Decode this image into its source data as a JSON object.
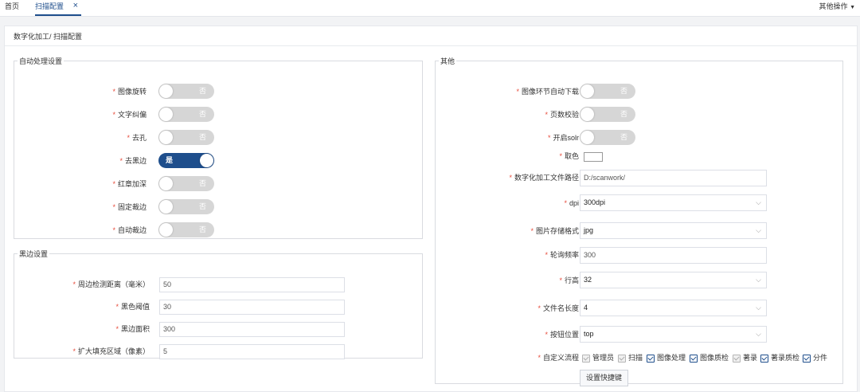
{
  "tabs": {
    "home": "首页",
    "active": "扫描配置",
    "close": "×"
  },
  "more_ops": "其他操作",
  "breadcrumb": "数字化加工/ 扫描配置",
  "auto_process": {
    "legend": "自动处理设置",
    "items": [
      {
        "label": "图像旋转",
        "state": "否",
        "on": false
      },
      {
        "label": "文字纠偏",
        "state": "否",
        "on": false
      },
      {
        "label": "去孔",
        "state": "否",
        "on": false
      },
      {
        "label": "去黑边",
        "state": "是",
        "on": true
      },
      {
        "label": "红章加深",
        "state": "否",
        "on": false
      },
      {
        "label": "固定裁边",
        "state": "否",
        "on": false
      },
      {
        "label": "自动裁边",
        "state": "否",
        "on": false
      }
    ]
  },
  "black_edge": {
    "legend": "黑边设置",
    "items": [
      {
        "label": "周边检测距离（毫米）",
        "value": "50"
      },
      {
        "label": "黑色阈值",
        "value": "30"
      },
      {
        "label": "黑边面积",
        "value": "300"
      },
      {
        "label": "扩大填充区域（像素）",
        "value": "5"
      }
    ]
  },
  "other": {
    "legend": "其他",
    "auto_download": {
      "label": "图像环节自动下载",
      "state": "否"
    },
    "page_check": {
      "label": "页数校验",
      "state": "否"
    },
    "solr": {
      "label": "开启solr",
      "state": "否"
    },
    "color_pick": {
      "label": "取色"
    },
    "file_path": {
      "label": "数字化加工文件路径",
      "value": "D:/scanwork/"
    },
    "dpi": {
      "label": "dpi",
      "value": "300dpi"
    },
    "format": {
      "label": "图片存储格式",
      "value": "jpg"
    },
    "poll": {
      "label": "轮询频率",
      "value": "300"
    },
    "row_height": {
      "label": "行高",
      "value": "32"
    },
    "name_length": {
      "label": "文件名长度",
      "value": "4"
    },
    "button_pos": {
      "label": "按钮位置",
      "value": "top"
    },
    "workflow": {
      "label": "自定义流程",
      "items": [
        {
          "label": "管理员",
          "checked": true,
          "disabled": true
        },
        {
          "label": "扫描",
          "checked": true,
          "disabled": true
        },
        {
          "label": "图像处理",
          "checked": true,
          "disabled": false
        },
        {
          "label": "图像质检",
          "checked": true,
          "disabled": false
        },
        {
          "label": "著录",
          "checked": true,
          "disabled": true
        },
        {
          "label": "著录质检",
          "checked": true,
          "disabled": false
        },
        {
          "label": "分件",
          "checked": true,
          "disabled": false
        }
      ]
    },
    "shortcut_button": "设置快捷键"
  },
  "colors": {
    "accent": "#1e4e8c",
    "required": "#e74c3c",
    "switch_off": "#d6d6d6"
  }
}
